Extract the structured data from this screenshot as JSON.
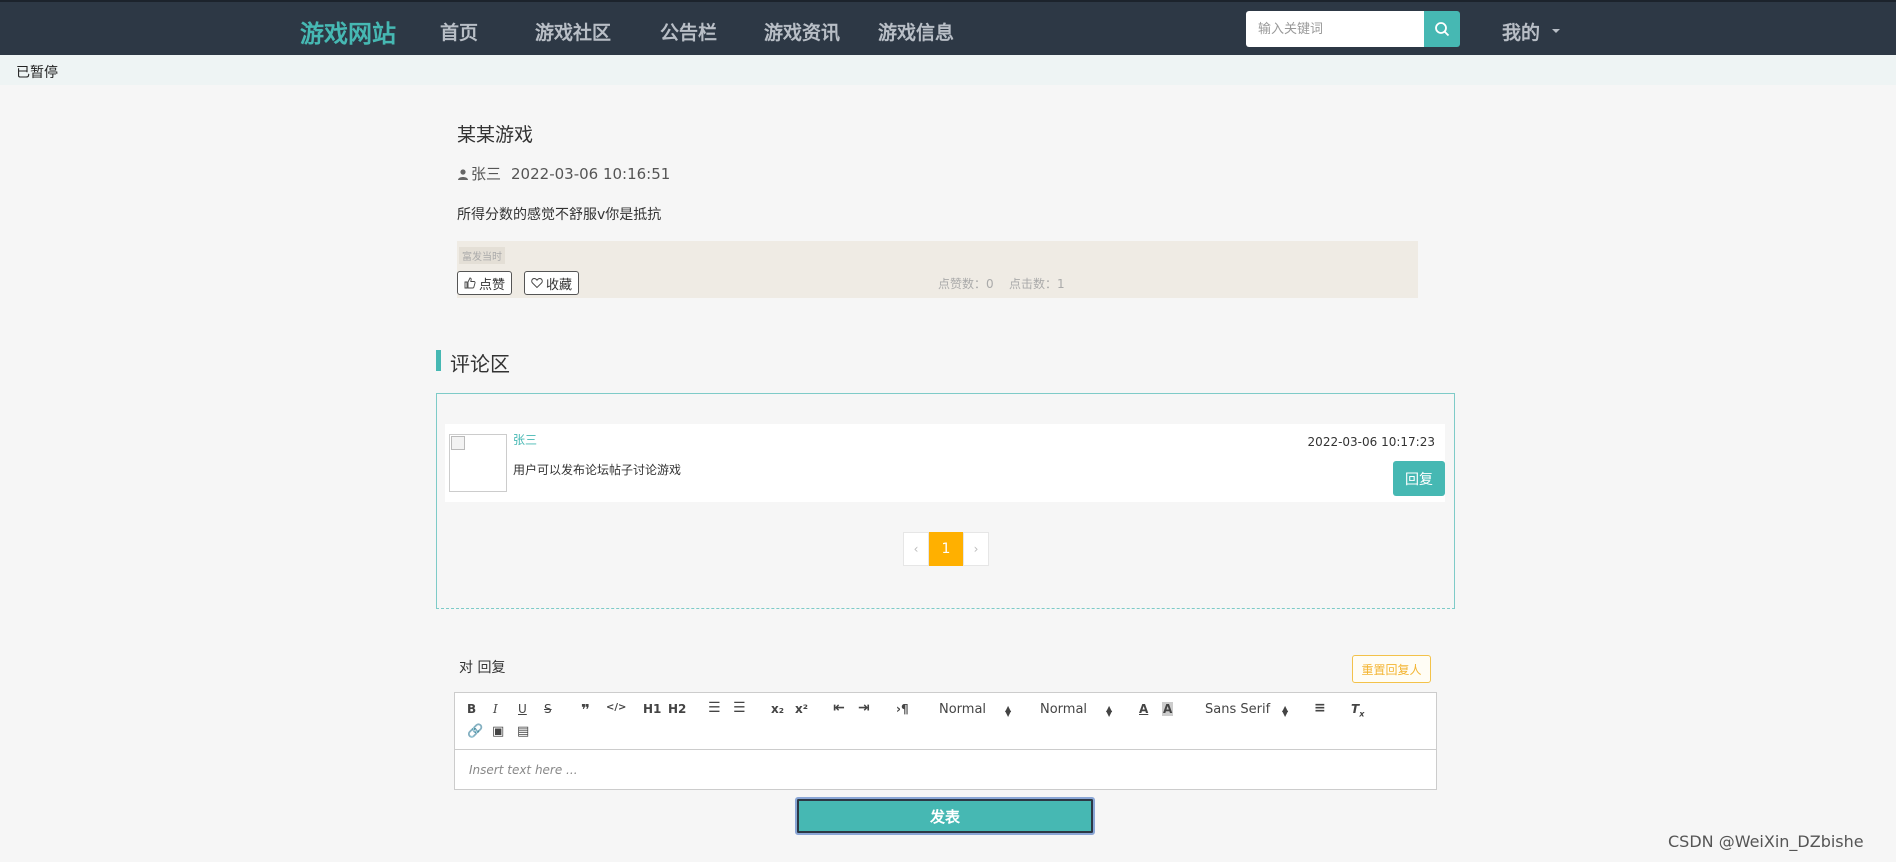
{
  "nav": {
    "logo": "游戏网站",
    "items": [
      "首页",
      "游戏社区",
      "公告栏",
      "游戏资讯",
      "游戏信息"
    ],
    "search_placeholder": "输入关键词",
    "mine": "我的",
    "accent_color": "#46b8b3",
    "bg_color": "#2d3845"
  },
  "status": {
    "pause_label": "已暂停"
  },
  "post": {
    "title": "某某游戏",
    "author": "张三",
    "date": "2022-03-06 10:16:51",
    "content": "所得分数的感觉不舒服v你是抵抗",
    "rich_tag": "富发当时",
    "like_label": "点赞",
    "fav_label": "收藏",
    "likes_text": "点赞数：0",
    "clicks_text": "点击数：1"
  },
  "comments": {
    "heading": "评论区",
    "list": [
      {
        "user": "张三",
        "text": "用户可以发布论坛帖子讨论游戏",
        "date": "2022-03-06 10:17:23",
        "reply_label": "回复"
      }
    ],
    "pager": {
      "prev": "‹",
      "current": "1",
      "next": "›"
    }
  },
  "reply_form": {
    "reply_to_label": "对 回复",
    "reset_label": "重置回复人",
    "toolbar": {
      "h1": "H1",
      "h2": "H2",
      "header_select": "Normal",
      "size_select": "Normal",
      "font_select": "Sans Serif"
    },
    "placeholder": "Insert text here ...",
    "submit_label": "发表"
  },
  "watermark": "CSDN @WeiXin_DZbishe"
}
